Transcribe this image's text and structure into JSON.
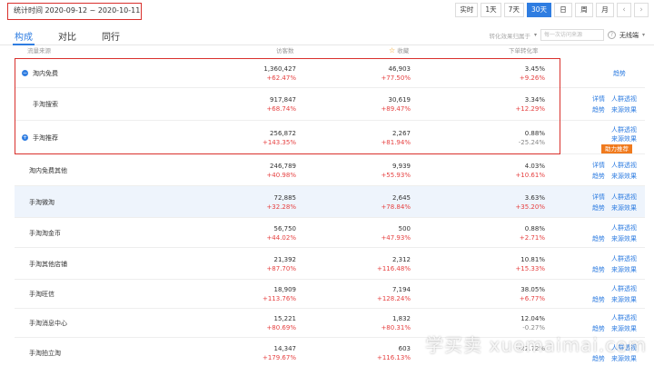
{
  "date_range": "统计时间 2020-09-12 ~ 2020-10-11",
  "periods": [
    {
      "label": "实时",
      "active": false
    },
    {
      "label": "1天",
      "active": false
    },
    {
      "label": "7天",
      "active": false
    },
    {
      "label": "30天",
      "active": true
    },
    {
      "label": "日",
      "active": false
    },
    {
      "label": "周",
      "active": false
    },
    {
      "label": "月",
      "active": false
    }
  ],
  "nav": {
    "prev": "‹",
    "next": "›"
  },
  "tabs": [
    {
      "label": "构成",
      "active": true
    },
    {
      "label": "对比",
      "active": false
    },
    {
      "label": "同行",
      "active": false
    }
  ],
  "filter": {
    "label": "转化效果归属于",
    "select_placeholder": "每一次访问来源",
    "help": "?",
    "device": "无线端"
  },
  "headers": {
    "source": "流量来源",
    "visitors": "访客数",
    "favorites": "收藏",
    "conversion": "下单转化率"
  },
  "rows": [
    {
      "name": "淘内免费",
      "toggle": "−",
      "visitors": "1,360,427",
      "visitors_change": "+62.47%",
      "favorites": "46,903",
      "favorites_change": "+77.50%",
      "conversion": "3.45%",
      "conversion_change": "+9.26%",
      "links": [
        "趋势"
      ]
    },
    {
      "name": "手淘搜索",
      "visitors": "917,847",
      "visitors_change": "+68.74%",
      "favorites": "30,619",
      "favorites_change": "+89.47%",
      "conversion": "3.34%",
      "conversion_change": "+12.29%",
      "links": [
        "详情",
        "人群透视",
        "趋势",
        "来源效果"
      ]
    },
    {
      "name": "手淘推荐",
      "toggle": "+",
      "visitors": "256,872",
      "visitors_change": "+143.35%",
      "favorites": "2,267",
      "favorites_change": "+81.94%",
      "conversion": "0.88%",
      "conversion_change": "-25.24%",
      "links": [
        "人群透视",
        "来源效果"
      ],
      "badge": "助力推荐"
    },
    {
      "name": "淘内免费其他",
      "visitors": "246,789",
      "visitors_change": "+40.98%",
      "favorites": "9,939",
      "favorites_change": "+55.93%",
      "conversion": "4.03%",
      "conversion_change": "+10.61%",
      "links": [
        "详情",
        "人群透视",
        "趋势",
        "来源效果"
      ]
    },
    {
      "name": "手淘微淘",
      "visitors": "72,885",
      "visitors_change": "+32.28%",
      "favorites": "2,645",
      "favorites_change": "+78.84%",
      "conversion": "3.63%",
      "conversion_change": "+35.20%",
      "links": [
        "详情",
        "人群透视",
        "趋势",
        "来源效果"
      ]
    },
    {
      "name": "手淘淘金币",
      "visitors": "56,750",
      "visitors_change": "+44.02%",
      "favorites": "500",
      "favorites_change": "+47.93%",
      "conversion": "0.88%",
      "conversion_change": "+2.71%",
      "links": [
        "人群透视",
        "趋势",
        "来源效果"
      ]
    },
    {
      "name": "手淘其他店铺",
      "visitors": "21,392",
      "visitors_change": "+87.70%",
      "favorites": "2,312",
      "favorites_change": "+116.48%",
      "conversion": "10.81%",
      "conversion_change": "+15.33%",
      "links": [
        "人群透视",
        "趋势",
        "来源效果"
      ]
    },
    {
      "name": "手淘旺信",
      "visitors": "18,909",
      "visitors_change": "+113.76%",
      "favorites": "7,194",
      "favorites_change": "+128.24%",
      "conversion": "38.05%",
      "conversion_change": "+6.77%",
      "links": [
        "人群透视",
        "趋势",
        "来源效果"
      ]
    },
    {
      "name": "手淘消息中心",
      "visitors": "15,221",
      "visitors_change": "+80.69%",
      "favorites": "1,832",
      "favorites_change": "+80.31%",
      "conversion": "12.04%",
      "conversion_change": "-0.27%",
      "links": [
        "人群透视",
        "趋势",
        "来源效果"
      ]
    },
    {
      "name": "手淘拍立淘",
      "visitors": "14,347",
      "visitors_change": "+179.67%",
      "favorites": "603",
      "favorites_change": "+116.13%",
      "conversion": "",
      "conversion_change": "-22.72%",
      "links": [
        "人群透视",
        "趋势",
        "来源效果"
      ]
    }
  ],
  "watermark": "学买卖 xuemaimai.com"
}
